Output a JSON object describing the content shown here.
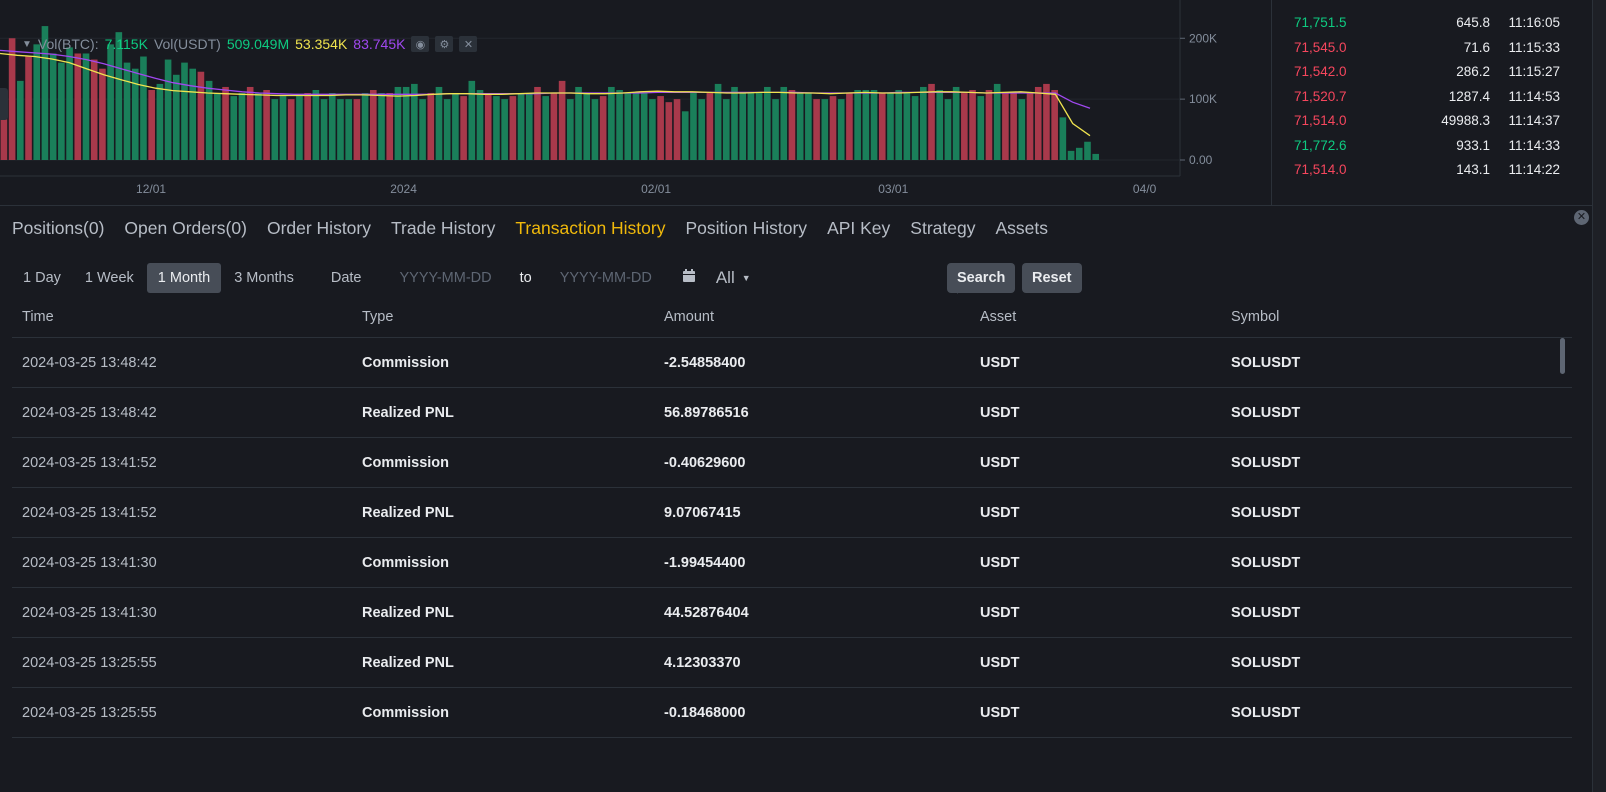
{
  "volume_panel": {
    "legend_label_btc": "Vol(BTC):",
    "legend_value_btc": "7.115K",
    "legend_label_usdt": "Vol(USDT)",
    "legend_value_usdt": "509.049M",
    "legend_ma1": "53.354K",
    "legend_ma2": "83.745K",
    "colors": {
      "up": "#0ecb81",
      "down": "#f6465d",
      "bar_up": "#1a7f5a",
      "bar_down": "#a8394b",
      "ma1": "#f0e44f",
      "ma2": "#a048f0"
    },
    "icons": [
      "eye-icon",
      "gear-icon",
      "close-icon"
    ]
  },
  "chart_data": {
    "type": "bar",
    "title": "",
    "y_ticks": [
      "200K",
      "100K",
      "0.00"
    ],
    "x_ticks": [
      "12/01",
      "2024",
      "02/01",
      "03/01",
      "04/0"
    ],
    "ylim": [
      0,
      230
    ],
    "unit": "K",
    "series": [
      {
        "name": "Vol(BTC)",
        "values": [
          110,
          200,
          130,
          170,
          190,
          220,
          175,
          160,
          185,
          175,
          175,
          165,
          150,
          190,
          210,
          160,
          150,
          170,
          115,
          125,
          165,
          140,
          160,
          150,
          145,
          130,
          110,
          120,
          105,
          110,
          120,
          110,
          115,
          100,
          105,
          100,
          105,
          110,
          115,
          100,
          110,
          100,
          100,
          100,
          110,
          115,
          110,
          110,
          120,
          120,
          125,
          100,
          110,
          120,
          100,
          110,
          105,
          130,
          115,
          110,
          105,
          100,
          105,
          110,
          110,
          120,
          105,
          110,
          130,
          100,
          120,
          110,
          100,
          105,
          120,
          115,
          110,
          110,
          110,
          100,
          105,
          95,
          100,
          80,
          110,
          100,
          110,
          125,
          100,
          120,
          110,
          110,
          110,
          120,
          100,
          120,
          115,
          110,
          110,
          100,
          100,
          105,
          100,
          110,
          115,
          115,
          115,
          110,
          110,
          115,
          110,
          105,
          120,
          125,
          115,
          100,
          120,
          110,
          115,
          105,
          115,
          125,
          110,
          110,
          100,
          110,
          120,
          125,
          115,
          70,
          15,
          20,
          30,
          10
        ],
        "colors": [
          "d",
          "d",
          "u",
          "d",
          "u",
          "u",
          "u",
          "u",
          "u",
          "d",
          "u",
          "d",
          "d",
          "u",
          "u",
          "u",
          "u",
          "u",
          "d",
          "u",
          "u",
          "u",
          "u",
          "u",
          "d",
          "u",
          "u",
          "d",
          "u",
          "u",
          "d",
          "u",
          "d",
          "u",
          "u",
          "d",
          "u",
          "d",
          "u",
          "u",
          "u",
          "u",
          "u",
          "d",
          "u",
          "d",
          "u",
          "d",
          "u",
          "u",
          "u",
          "u",
          "d",
          "u",
          "u",
          "u",
          "d",
          "u",
          "u",
          "d",
          "u",
          "u",
          "d",
          "u",
          "u",
          "d",
          "u",
          "d",
          "d",
          "u",
          "u",
          "u",
          "u",
          "d",
          "u",
          "u",
          "u",
          "u",
          "u",
          "u",
          "d",
          "d",
          "d",
          "u",
          "u",
          "u",
          "d",
          "u",
          "u",
          "u",
          "u",
          "u",
          "u",
          "u",
          "u",
          "u",
          "d",
          "u",
          "u",
          "d",
          "u",
          "d",
          "u",
          "d",
          "u",
          "u",
          "u",
          "d",
          "u",
          "u",
          "u",
          "u",
          "u",
          "d",
          "u",
          "u",
          "u",
          "d",
          "d",
          "u",
          "d",
          "u",
          "d",
          "d",
          "u",
          "d",
          "d",
          "d",
          "d",
          "u",
          "u",
          "u",
          "u",
          "u"
        ]
      },
      {
        "name": "MA1",
        "values": [
          175,
          172,
          170,
          166,
          160,
          150,
          140,
          132,
          124,
          118,
          114,
          112,
          110,
          109,
          108,
          107,
          106,
          106,
          106,
          106,
          107,
          107,
          106,
          105,
          106,
          108,
          109,
          109,
          108,
          108,
          109,
          110,
          110,
          110,
          109,
          109,
          110,
          112,
          113,
          112,
          112,
          111,
          110,
          110,
          111,
          111,
          110,
          110,
          109,
          110,
          111,
          110,
          110,
          111,
          112,
          112,
          111,
          110,
          111,
          112,
          110,
          108,
          60,
          40
        ]
      },
      {
        "name": "MA2",
        "values": [
          180,
          178,
          176,
          174,
          170,
          165,
          158,
          150,
          142,
          134,
          127,
          122,
          118,
          115,
          112,
          110,
          109,
          108,
          108,
          108,
          108,
          108,
          108,
          108,
          108,
          108,
          109,
          109,
          109,
          109,
          109,
          109,
          110,
          110,
          110,
          110,
          110,
          110,
          111,
          111,
          111,
          111,
          111,
          111,
          111,
          111,
          111,
          110,
          110,
          110,
          110,
          110,
          111,
          111,
          111,
          111,
          111,
          110,
          110,
          110,
          110,
          110,
          95,
          85
        ]
      }
    ]
  },
  "recent_trades": [
    {
      "price": "71,751.5",
      "amount": "645.8",
      "time": "11:16:05",
      "dir": "up"
    },
    {
      "price": "71,545.0",
      "amount": "71.6",
      "time": "11:15:33",
      "dir": "down"
    },
    {
      "price": "71,542.0",
      "amount": "286.2",
      "time": "11:15:27",
      "dir": "down"
    },
    {
      "price": "71,520.7",
      "amount": "1287.4",
      "time": "11:14:53",
      "dir": "down"
    },
    {
      "price": "71,514.0",
      "amount": "49988.3",
      "time": "11:14:37",
      "dir": "down"
    },
    {
      "price": "71,772.6",
      "amount": "933.1",
      "time": "11:14:33",
      "dir": "up"
    },
    {
      "price": "71,514.0",
      "amount": "143.1",
      "time": "11:14:22",
      "dir": "down"
    }
  ],
  "tabs": [
    "Positions(0)",
    "Open Orders(0)",
    "Order History",
    "Trade History",
    "Transaction History",
    "Position History",
    "API Key",
    "Strategy",
    "Assets"
  ],
  "active_tab": "Transaction History",
  "filters": {
    "ranges": [
      "1 Day",
      "1 Week",
      "1 Month",
      "3 Months"
    ],
    "active_range": "1 Month",
    "date_label": "Date",
    "start_placeholder": "YYYY-MM-DD",
    "to_label": "to",
    "end_placeholder": "YYYY-MM-DD",
    "type_value": "All",
    "search_label": "Search",
    "reset_label": "Reset"
  },
  "table": {
    "columns": [
      "Time",
      "Type",
      "Amount",
      "Asset",
      "Symbol"
    ],
    "rows": [
      [
        "2024-03-25 13:48:42",
        "Commission",
        "-2.54858400",
        "USDT",
        "SOLUSDT"
      ],
      [
        "2024-03-25 13:48:42",
        "Realized PNL",
        "56.89786516",
        "USDT",
        "SOLUSDT"
      ],
      [
        "2024-03-25 13:41:52",
        "Commission",
        "-0.40629600",
        "USDT",
        "SOLUSDT"
      ],
      [
        "2024-03-25 13:41:52",
        "Realized PNL",
        "9.07067415",
        "USDT",
        "SOLUSDT"
      ],
      [
        "2024-03-25 13:41:30",
        "Commission",
        "-1.99454400",
        "USDT",
        "SOLUSDT"
      ],
      [
        "2024-03-25 13:41:30",
        "Realized PNL",
        "44.52876404",
        "USDT",
        "SOLUSDT"
      ],
      [
        "2024-03-25 13:25:55",
        "Realized PNL",
        "4.12303370",
        "USDT",
        "SOLUSDT"
      ],
      [
        "2024-03-25 13:25:55",
        "Commission",
        "-0.18468000",
        "USDT",
        "SOLUSDT"
      ]
    ]
  }
}
